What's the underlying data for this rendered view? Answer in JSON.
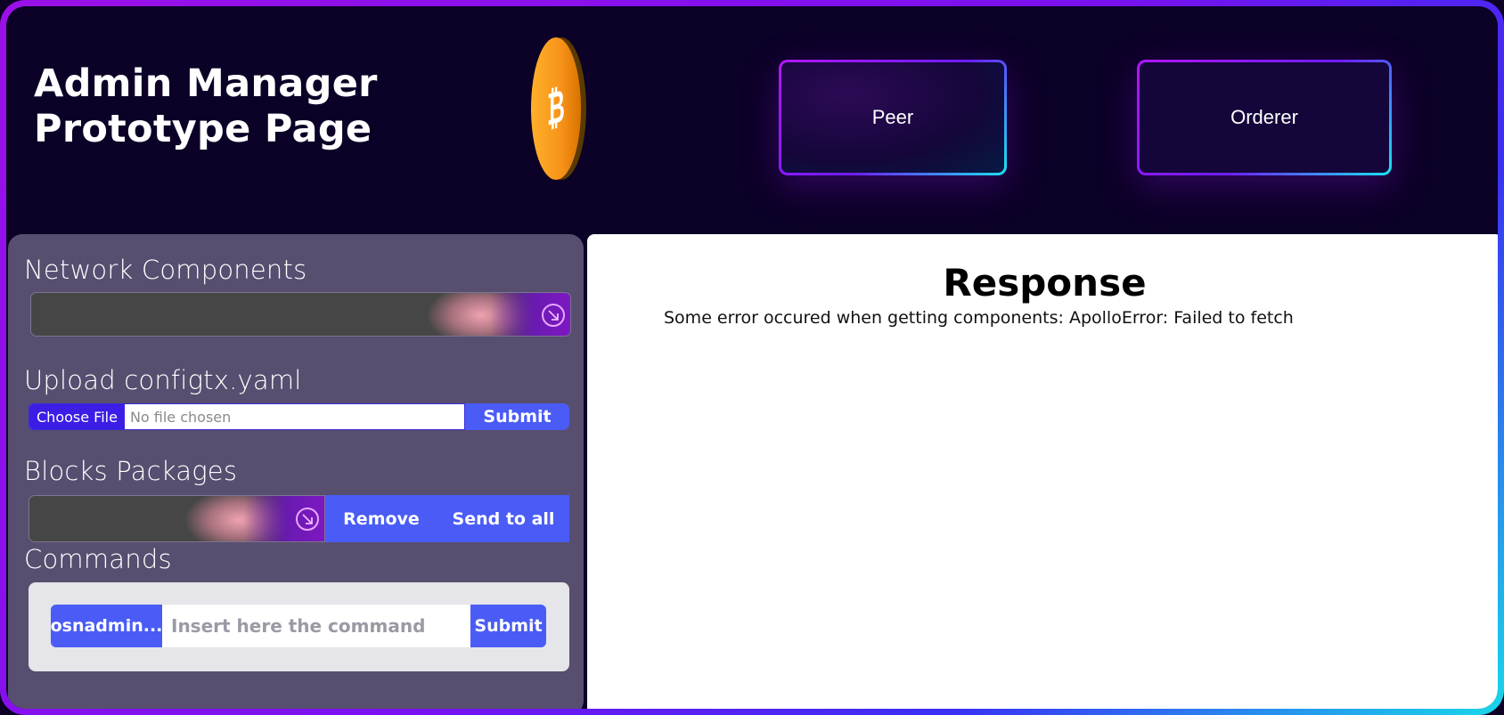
{
  "header": {
    "title_line1": "Admin Manager",
    "title_line2": "Prototype Page",
    "logo_icon": "bitcoin-coin-icon",
    "nav": [
      {
        "label": "Peer"
      },
      {
        "label": "Orderer"
      }
    ]
  },
  "left_panel": {
    "network_components": {
      "label": "Network Components",
      "selected": "",
      "arrow_icon": "arrow-down-right-icon"
    },
    "upload": {
      "label": "Upload configtx.yaml",
      "choose_label": "Choose File",
      "file_status": "No file chosen",
      "submit_label": "Submit"
    },
    "blocks": {
      "label": "Blocks Packages",
      "selected": "",
      "remove_label": "Remove",
      "send_label": "Send to all"
    },
    "commands": {
      "label": "Commands",
      "command_type": "osnadmin...",
      "placeholder": "Insert here the command",
      "value": "",
      "submit_label": "Submit"
    }
  },
  "response": {
    "title": "Response",
    "message": "Some error occured when getting components: ApolloError: Failed to fetch"
  },
  "colors": {
    "background": "#0c0127",
    "panel": "#574e70",
    "button_blue": "#4a5cf5",
    "coin": "#f7931a"
  }
}
